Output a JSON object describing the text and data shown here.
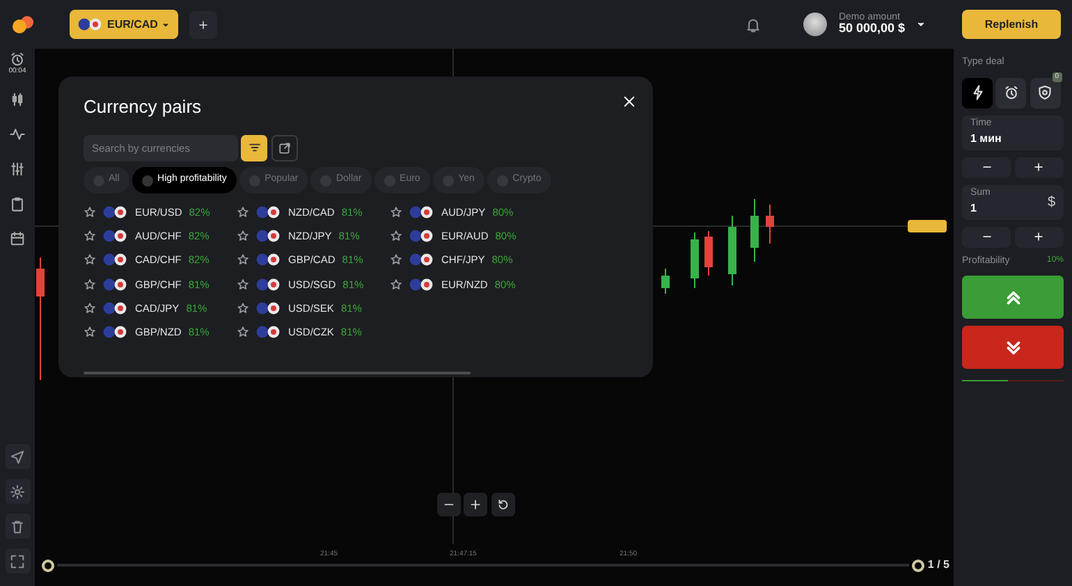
{
  "header": {
    "pair": "EUR/CAD",
    "account_label": "Demo amount",
    "balance": "50 000,00 $",
    "replenish": "Replenish"
  },
  "left_sidebar": {
    "timer": "00:04"
  },
  "modal": {
    "title": "Currency pairs",
    "search": {
      "placeholder": "Search by currencies"
    },
    "filters": [
      {
        "label": "All",
        "selected": false
      },
      {
        "label": "High profitability",
        "selected": true
      },
      {
        "label": "Popular",
        "selected": false
      },
      {
        "label": "Dollar",
        "selected": false
      },
      {
        "label": "Euro",
        "selected": false
      },
      {
        "label": "Yen",
        "selected": false
      },
      {
        "label": "Crypto",
        "selected": false
      }
    ],
    "columns": [
      [
        {
          "pair": "EUR/USD",
          "profit": "82%"
        },
        {
          "pair": "AUD/CHF",
          "profit": "82%"
        },
        {
          "pair": "CAD/CHF",
          "profit": "82%"
        },
        {
          "pair": "GBP/CHF",
          "profit": "81%"
        },
        {
          "pair": "CAD/JPY",
          "profit": "81%"
        },
        {
          "pair": "GBP/NZD",
          "profit": "81%"
        }
      ],
      [
        {
          "pair": "NZD/CAD",
          "profit": "81%"
        },
        {
          "pair": "NZD/JPY",
          "profit": "81%"
        },
        {
          "pair": "GBP/CAD",
          "profit": "81%"
        },
        {
          "pair": "USD/SGD",
          "profit": "81%"
        },
        {
          "pair": "USD/SEK",
          "profit": "81%"
        },
        {
          "pair": "USD/CZK",
          "profit": "81%"
        }
      ],
      [
        {
          "pair": "AUD/JPY",
          "profit": "80%"
        },
        {
          "pair": "EUR/AUD",
          "profit": "80%"
        },
        {
          "pair": "CHF/JPY",
          "profit": "80%"
        },
        {
          "pair": "EUR/NZD",
          "profit": "80%"
        }
      ]
    ]
  },
  "trade_panel": {
    "type_label": "Type deal",
    "deal_types": [
      {
        "kind": "lightning",
        "selected": true
      },
      {
        "kind": "alarm",
        "selected": false
      },
      {
        "kind": "shield",
        "selected": false,
        "badge": "0"
      }
    ],
    "time_label": "Time",
    "time_value": "1 мин",
    "sum_label": "Sum",
    "sum_value": "1",
    "currency": "$",
    "profitability_label": "Profitability",
    "profitability": "10%",
    "level": 0.45
  },
  "chart": {
    "time_labels": [
      "21:45",
      "21:47:15",
      "21:50"
    ],
    "page": "1 / 5"
  }
}
